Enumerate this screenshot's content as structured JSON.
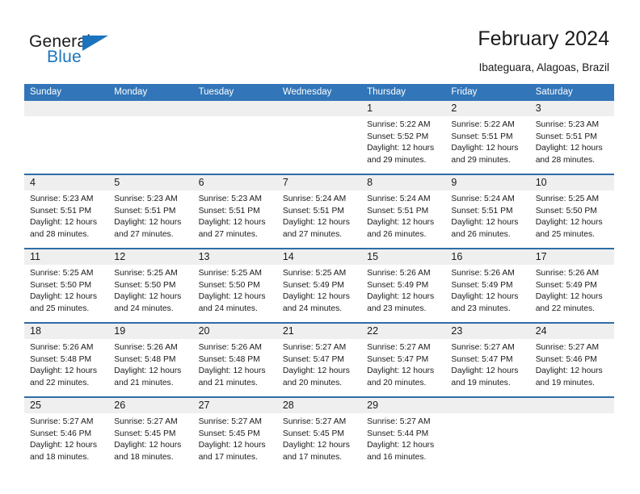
{
  "brand": {
    "word_one": "General",
    "word_two": "Blue",
    "accent_color": "#1b74bd"
  },
  "header": {
    "title": "February 2024",
    "location": "Ibateguara, Alagoas, Brazil"
  },
  "theme": {
    "header_blue": "#3275b8",
    "row_separator_blue": "#2e6da8",
    "daynum_band_gray": "#efefef"
  },
  "weekdays": [
    "Sunday",
    "Monday",
    "Tuesday",
    "Wednesday",
    "Thursday",
    "Friday",
    "Saturday"
  ],
  "weeks": [
    [
      {
        "day": "",
        "lines": []
      },
      {
        "day": "",
        "lines": []
      },
      {
        "day": "",
        "lines": []
      },
      {
        "day": "",
        "lines": []
      },
      {
        "day": "1",
        "lines": [
          "Sunrise: 5:22 AM",
          "Sunset: 5:52 PM",
          "Daylight: 12 hours",
          "and 29 minutes."
        ]
      },
      {
        "day": "2",
        "lines": [
          "Sunrise: 5:22 AM",
          "Sunset: 5:51 PM",
          "Daylight: 12 hours",
          "and 29 minutes."
        ]
      },
      {
        "day": "3",
        "lines": [
          "Sunrise: 5:23 AM",
          "Sunset: 5:51 PM",
          "Daylight: 12 hours",
          "and 28 minutes."
        ]
      }
    ],
    [
      {
        "day": "4",
        "lines": [
          "Sunrise: 5:23 AM",
          "Sunset: 5:51 PM",
          "Daylight: 12 hours",
          "and 28 minutes."
        ]
      },
      {
        "day": "5",
        "lines": [
          "Sunrise: 5:23 AM",
          "Sunset: 5:51 PM",
          "Daylight: 12 hours",
          "and 27 minutes."
        ]
      },
      {
        "day": "6",
        "lines": [
          "Sunrise: 5:23 AM",
          "Sunset: 5:51 PM",
          "Daylight: 12 hours",
          "and 27 minutes."
        ]
      },
      {
        "day": "7",
        "lines": [
          "Sunrise: 5:24 AM",
          "Sunset: 5:51 PM",
          "Daylight: 12 hours",
          "and 27 minutes."
        ]
      },
      {
        "day": "8",
        "lines": [
          "Sunrise: 5:24 AM",
          "Sunset: 5:51 PM",
          "Daylight: 12 hours",
          "and 26 minutes."
        ]
      },
      {
        "day": "9",
        "lines": [
          "Sunrise: 5:24 AM",
          "Sunset: 5:51 PM",
          "Daylight: 12 hours",
          "and 26 minutes."
        ]
      },
      {
        "day": "10",
        "lines": [
          "Sunrise: 5:25 AM",
          "Sunset: 5:50 PM",
          "Daylight: 12 hours",
          "and 25 minutes."
        ]
      }
    ],
    [
      {
        "day": "11",
        "lines": [
          "Sunrise: 5:25 AM",
          "Sunset: 5:50 PM",
          "Daylight: 12 hours",
          "and 25 minutes."
        ]
      },
      {
        "day": "12",
        "lines": [
          "Sunrise: 5:25 AM",
          "Sunset: 5:50 PM",
          "Daylight: 12 hours",
          "and 24 minutes."
        ]
      },
      {
        "day": "13",
        "lines": [
          "Sunrise: 5:25 AM",
          "Sunset: 5:50 PM",
          "Daylight: 12 hours",
          "and 24 minutes."
        ]
      },
      {
        "day": "14",
        "lines": [
          "Sunrise: 5:25 AM",
          "Sunset: 5:49 PM",
          "Daylight: 12 hours",
          "and 24 minutes."
        ]
      },
      {
        "day": "15",
        "lines": [
          "Sunrise: 5:26 AM",
          "Sunset: 5:49 PM",
          "Daylight: 12 hours",
          "and 23 minutes."
        ]
      },
      {
        "day": "16",
        "lines": [
          "Sunrise: 5:26 AM",
          "Sunset: 5:49 PM",
          "Daylight: 12 hours",
          "and 23 minutes."
        ]
      },
      {
        "day": "17",
        "lines": [
          "Sunrise: 5:26 AM",
          "Sunset: 5:49 PM",
          "Daylight: 12 hours",
          "and 22 minutes."
        ]
      }
    ],
    [
      {
        "day": "18",
        "lines": [
          "Sunrise: 5:26 AM",
          "Sunset: 5:48 PM",
          "Daylight: 12 hours",
          "and 22 minutes."
        ]
      },
      {
        "day": "19",
        "lines": [
          "Sunrise: 5:26 AM",
          "Sunset: 5:48 PM",
          "Daylight: 12 hours",
          "and 21 minutes."
        ]
      },
      {
        "day": "20",
        "lines": [
          "Sunrise: 5:26 AM",
          "Sunset: 5:48 PM",
          "Daylight: 12 hours",
          "and 21 minutes."
        ]
      },
      {
        "day": "21",
        "lines": [
          "Sunrise: 5:27 AM",
          "Sunset: 5:47 PM",
          "Daylight: 12 hours",
          "and 20 minutes."
        ]
      },
      {
        "day": "22",
        "lines": [
          "Sunrise: 5:27 AM",
          "Sunset: 5:47 PM",
          "Daylight: 12 hours",
          "and 20 minutes."
        ]
      },
      {
        "day": "23",
        "lines": [
          "Sunrise: 5:27 AM",
          "Sunset: 5:47 PM",
          "Daylight: 12 hours",
          "and 19 minutes."
        ]
      },
      {
        "day": "24",
        "lines": [
          "Sunrise: 5:27 AM",
          "Sunset: 5:46 PM",
          "Daylight: 12 hours",
          "and 19 minutes."
        ]
      }
    ],
    [
      {
        "day": "25",
        "lines": [
          "Sunrise: 5:27 AM",
          "Sunset: 5:46 PM",
          "Daylight: 12 hours",
          "and 18 minutes."
        ]
      },
      {
        "day": "26",
        "lines": [
          "Sunrise: 5:27 AM",
          "Sunset: 5:45 PM",
          "Daylight: 12 hours",
          "and 18 minutes."
        ]
      },
      {
        "day": "27",
        "lines": [
          "Sunrise: 5:27 AM",
          "Sunset: 5:45 PM",
          "Daylight: 12 hours",
          "and 17 minutes."
        ]
      },
      {
        "day": "28",
        "lines": [
          "Sunrise: 5:27 AM",
          "Sunset: 5:45 PM",
          "Daylight: 12 hours",
          "and 17 minutes."
        ]
      },
      {
        "day": "29",
        "lines": [
          "Sunrise: 5:27 AM",
          "Sunset: 5:44 PM",
          "Daylight: 12 hours",
          "and 16 minutes."
        ]
      },
      {
        "day": "",
        "lines": []
      },
      {
        "day": "",
        "lines": []
      }
    ]
  ]
}
